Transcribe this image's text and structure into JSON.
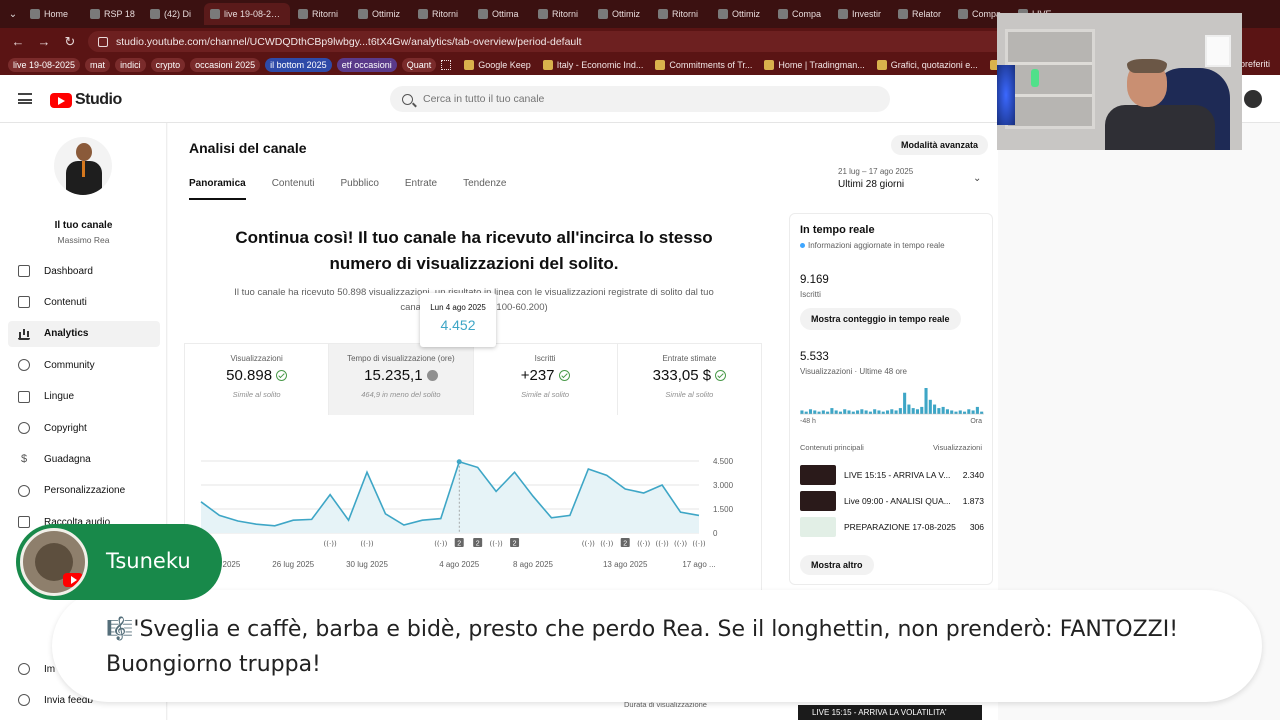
{
  "browser": {
    "tabs": [
      {
        "label": "Home"
      },
      {
        "label": "RSP 18"
      },
      {
        "label": "(42) Di"
      },
      {
        "label": "live 19-08-2025",
        "active": true
      },
      {
        "label": "Ritorni"
      },
      {
        "label": "Ottimiz"
      },
      {
        "label": "Ritorni"
      },
      {
        "label": "Ottima"
      },
      {
        "label": "Ritorni"
      },
      {
        "label": "Ottimiz"
      },
      {
        "label": "Ritorni"
      },
      {
        "label": "Ottimiz"
      },
      {
        "label": "Compa"
      },
      {
        "label": "Investir"
      },
      {
        "label": "Relator"
      },
      {
        "label": "Compa"
      },
      {
        "label": "LIVE"
      }
    ],
    "url": "studio.youtube.com/channel/UCWDQDthCBp9lwbgy...t6tX4Gw/analytics/tab-overview/period-default",
    "bookmark_chips": [
      "live 19-08-2025",
      "mat",
      "indici",
      "crypto",
      "occasioni 2025",
      "il bottom 2025",
      "etf occasioni",
      "Quant"
    ],
    "bookmark_links": [
      "Google Keep",
      "Italy - Economic Ind...",
      "Commitments of Tr...",
      "Home | Tradingman...",
      "Grafici, quotazioni e...",
      "Grafici Indici Live - I..."
    ],
    "bookmark_right": "preferiti"
  },
  "studio": {
    "logo_text": "Studio",
    "search_placeholder": "Cerca in tutto il tuo canale",
    "channel": {
      "label": "Il tuo canale",
      "owner": "Massimo Rea"
    },
    "nav": [
      {
        "label": "Dashboard",
        "icon": "dashboard-icon"
      },
      {
        "label": "Contenuti",
        "icon": "content-icon"
      },
      {
        "label": "Analytics",
        "icon": "analytics-icon",
        "active": true
      },
      {
        "label": "Community",
        "icon": "community-icon"
      },
      {
        "label": "Lingue",
        "icon": "subtitles-icon"
      },
      {
        "label": "Copyright",
        "icon": "copyright-icon"
      },
      {
        "label": "Guadagna",
        "icon": "dollar-icon"
      },
      {
        "label": "Personalizzazione",
        "icon": "brush-icon"
      },
      {
        "label": "Raccolta audio",
        "icon": "audio-icon"
      }
    ],
    "nav_bottom": [
      {
        "label": "Impostazioni",
        "visible": "Im",
        "icon": "gear-icon"
      },
      {
        "label": "Invia feedback",
        "visible": "Invia feedb",
        "icon": "feedback-icon"
      }
    ],
    "page_title": "Analisi del canale",
    "tabs": [
      "Panoramica",
      "Contenuti",
      "Pubblico",
      "Entrate",
      "Tendenze"
    ],
    "advanced_button": "Modalità avanzata",
    "period": {
      "range": "21 lug – 17 ago 2025",
      "label": "Ultimi 28 giorni"
    },
    "headline": "Continua così! Il tuo canale ha ricevuto all'incirca lo stesso numero di visualizzazioni del solito.",
    "subline": "Il tuo canale ha ricevuto 50.898 visualizzazioni, un risultato in linea con le visualizzazioni registrate di solito dal tuo canale in 28 giorni (49.100-60.200)",
    "metrics": [
      {
        "label": "Visualizzazioni",
        "value": "50.898",
        "status": "check",
        "sub": "Simile al solito"
      },
      {
        "label": "Tempo di visualizzazione (ore)",
        "value": "15.235,1",
        "status": "info",
        "sub": "464,9 in meno del solito"
      },
      {
        "label": "Iscritti",
        "value": "+237",
        "status": "check",
        "sub": "Simile al solito"
      },
      {
        "label": "Entrate stimate",
        "value": "333,05 $",
        "status": "check",
        "sub": "Simile al solito"
      }
    ],
    "tooltip": {
      "date": "Lun 4 ago 2025",
      "value": "4.452"
    },
    "realtime": {
      "title": "In tempo reale",
      "live_note": "Informazioni aggiornate in tempo reale",
      "subscribers": "9.169",
      "subscribers_label": "Iscritti",
      "live_count_button": "Mostra conteggio in tempo reale",
      "views": "5.533",
      "views_label": "Visualizzazioni · Ultime 48 ore",
      "axis_start": "-48 h",
      "axis_end": "Ora",
      "top_content_label": "Contenuti principali",
      "top_content_col": "Visualizzazioni",
      "top_content": [
        {
          "title": "LIVE 15:15 - ARRIVA LA V...",
          "views": "2.340",
          "thumb": "dark"
        },
        {
          "title": "Live 09:00 - ANALISI QUA...",
          "views": "1.873",
          "thumb": "dark"
        },
        {
          "title": "PREPARAZIONE 17-08-2025",
          "views": "306",
          "thumb": "light"
        }
      ],
      "more_button": "Mostra altro",
      "spark": [
        3,
        2,
        4,
        3,
        2,
        3,
        2,
        5,
        3,
        2,
        4,
        3,
        2,
        3,
        4,
        3,
        2,
        4,
        3,
        2,
        3,
        4,
        3,
        5,
        18,
        8,
        5,
        4,
        6,
        22,
        12,
        8,
        5,
        6,
        4,
        3,
        2,
        3,
        2,
        4,
        3,
        6,
        2
      ]
    },
    "bottom_hint": "Durata di visualizzazione",
    "bottom_thumb_text": "LIVE 15:15 - ARRIVA LA VOLATILITA'"
  },
  "chat": {
    "username": "Tsuneku",
    "message": "🎼'Sveglia e caffè, barba e bidè, presto che perdo Rea. Se il longhettin, non prenderò: FANTOZZI! Buongiorno truppa!"
  },
  "chart_data": {
    "type": "area",
    "title": "",
    "xlabel": "",
    "ylabel": "",
    "ylim": [
      0,
      4500
    ],
    "y_ticks": [
      0,
      1500,
      3000,
      4500
    ],
    "y_tick_labels": [
      "0",
      "1.500",
      "3.000",
      "4.500"
    ],
    "x_tick_labels": [
      {
        "date": "2025-07-22",
        "label": "22 lug 2025"
      },
      {
        "date": "2025-07-26",
        "label": "26 lug 2025"
      },
      {
        "date": "2025-07-30",
        "label": "30 lug 2025"
      },
      {
        "date": "2025-08-04",
        "label": "4 ago 2025"
      },
      {
        "date": "2025-08-08",
        "label": "8 ago 2025"
      },
      {
        "date": "2025-08-13",
        "label": "13 ago 2025"
      },
      {
        "date": "2025-08-17",
        "label": "17 ago ..."
      }
    ],
    "x": [
      "2025-07-21",
      "2025-07-22",
      "2025-07-23",
      "2025-07-24",
      "2025-07-25",
      "2025-07-26",
      "2025-07-27",
      "2025-07-28",
      "2025-07-29",
      "2025-07-30",
      "2025-07-31",
      "2025-08-01",
      "2025-08-02",
      "2025-08-03",
      "2025-08-04",
      "2025-08-05",
      "2025-08-06",
      "2025-08-07",
      "2025-08-08",
      "2025-08-09",
      "2025-08-10",
      "2025-08-11",
      "2025-08-12",
      "2025-08-13",
      "2025-08-14",
      "2025-08-15",
      "2025-08-16",
      "2025-08-17"
    ],
    "series": [
      {
        "values": [
          1950,
          1100,
          750,
          550,
          450,
          800,
          850,
          2400,
          800,
          3800,
          1200,
          500,
          800,
          900,
          4452,
          4100,
          2600,
          3800,
          2300,
          950,
          1100,
          4000,
          3600,
          2750,
          2500,
          3000,
          1300,
          1100
        ]
      }
    ],
    "highlight_date": "2025-08-04",
    "color": "#3ea6c6",
    "grid": true,
    "event_markers": [
      {
        "date": "2025-07-28",
        "kind": "live"
      },
      {
        "date": "2025-07-30",
        "kind": "live"
      },
      {
        "date": "2025-08-03",
        "kind": "live"
      },
      {
        "date": "2025-08-04",
        "kind": "badge",
        "label": "2"
      },
      {
        "date": "2025-08-05",
        "kind": "badge",
        "label": "2"
      },
      {
        "date": "2025-08-06",
        "kind": "live"
      },
      {
        "date": "2025-08-07",
        "kind": "badge",
        "label": "2"
      },
      {
        "date": "2025-08-11",
        "kind": "live"
      },
      {
        "date": "2025-08-12",
        "kind": "live"
      },
      {
        "date": "2025-08-13",
        "kind": "badge",
        "label": "2"
      },
      {
        "date": "2025-08-14",
        "kind": "live"
      },
      {
        "date": "2025-08-15",
        "kind": "live"
      },
      {
        "date": "2025-08-16",
        "kind": "live"
      },
      {
        "date": "2025-08-17",
        "kind": "live"
      }
    ]
  }
}
